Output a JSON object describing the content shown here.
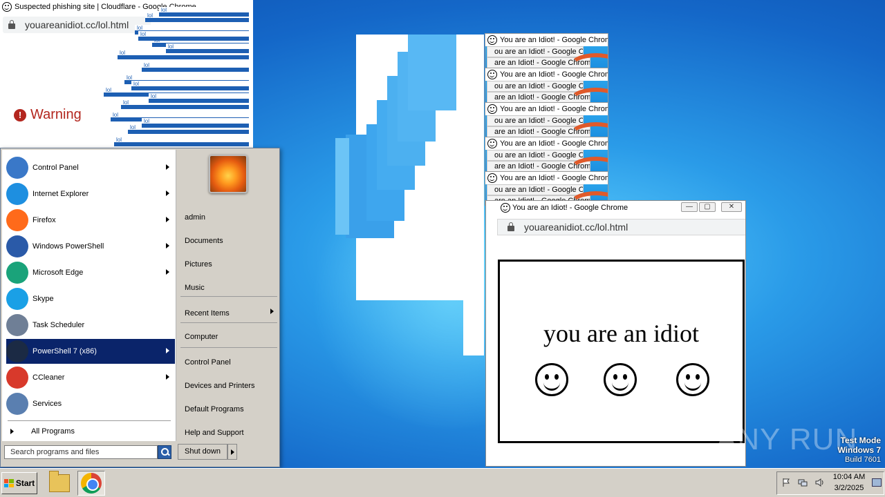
{
  "left_window": {
    "title": "Suspected phishing site | Cloudflare - Google Chrome",
    "url": "youareanidiot.cc/lol.html",
    "warning": "Warning",
    "lol_text": "lol"
  },
  "cascade_windows": {
    "title": "You are an Idiot! - Google Chrome",
    "title_frag": "ou are an Idiot! - Google Chrome",
    "title_frag2": "are an Idiot! - Google Chrome",
    "title_frag3": "an Idiot! - Google Chrome"
  },
  "main_window": {
    "title": "You are an Idiot! - Google Chrome",
    "url": "youareanidiot.cc/lol.html",
    "message": "you are an idiot",
    "minimize": "—",
    "maximize": "▢",
    "close": "✕"
  },
  "start_menu": {
    "programs": [
      {
        "label": "Control Panel",
        "icon": "control-panel-icon",
        "color": "#3a78c8"
      },
      {
        "label": "Internet Explorer",
        "icon": "internet-explorer-icon",
        "color": "#1e8fe0"
      },
      {
        "label": "Firefox",
        "icon": "firefox-icon",
        "color": "#ff6a1a"
      },
      {
        "label": "Windows PowerShell",
        "icon": "powershell-icon",
        "color": "#2a5aa8"
      },
      {
        "label": "Microsoft Edge",
        "icon": "edge-icon",
        "color": "#1aa37a"
      },
      {
        "label": "Skype",
        "icon": "skype-icon",
        "color": "#1aa0e6"
      },
      {
        "label": "Task Scheduler",
        "icon": "task-scheduler-icon",
        "color": "#6f7f96"
      },
      {
        "label": "PowerShell 7 (x86)",
        "icon": "powershell7-icon",
        "color": "#1b2a44"
      },
      {
        "label": "CCleaner",
        "icon": "ccleaner-icon",
        "color": "#d8392b"
      },
      {
        "label": "Services",
        "icon": "services-icon",
        "color": "#5a7fb0"
      }
    ],
    "all_programs": "All Programs",
    "search_placeholder": "Search programs and files",
    "right_links": {
      "admin": "admin",
      "documents": "Documents",
      "pictures": "Pictures",
      "music": "Music",
      "recent_items": "Recent Items",
      "computer": "Computer",
      "control_panel": "Control Panel",
      "devices_printers": "Devices and Printers",
      "default_programs": "Default Programs",
      "help_support": "Help and Support"
    },
    "shutdown": "Shut down"
  },
  "taskbar": {
    "start": "Start",
    "time": "10:04 AM",
    "date": "3/2/2025"
  },
  "watermark": {
    "line1": "Test Mode",
    "line2": "Windows 7",
    "line3": "Build 7601",
    "brand": "ANY RUN"
  }
}
